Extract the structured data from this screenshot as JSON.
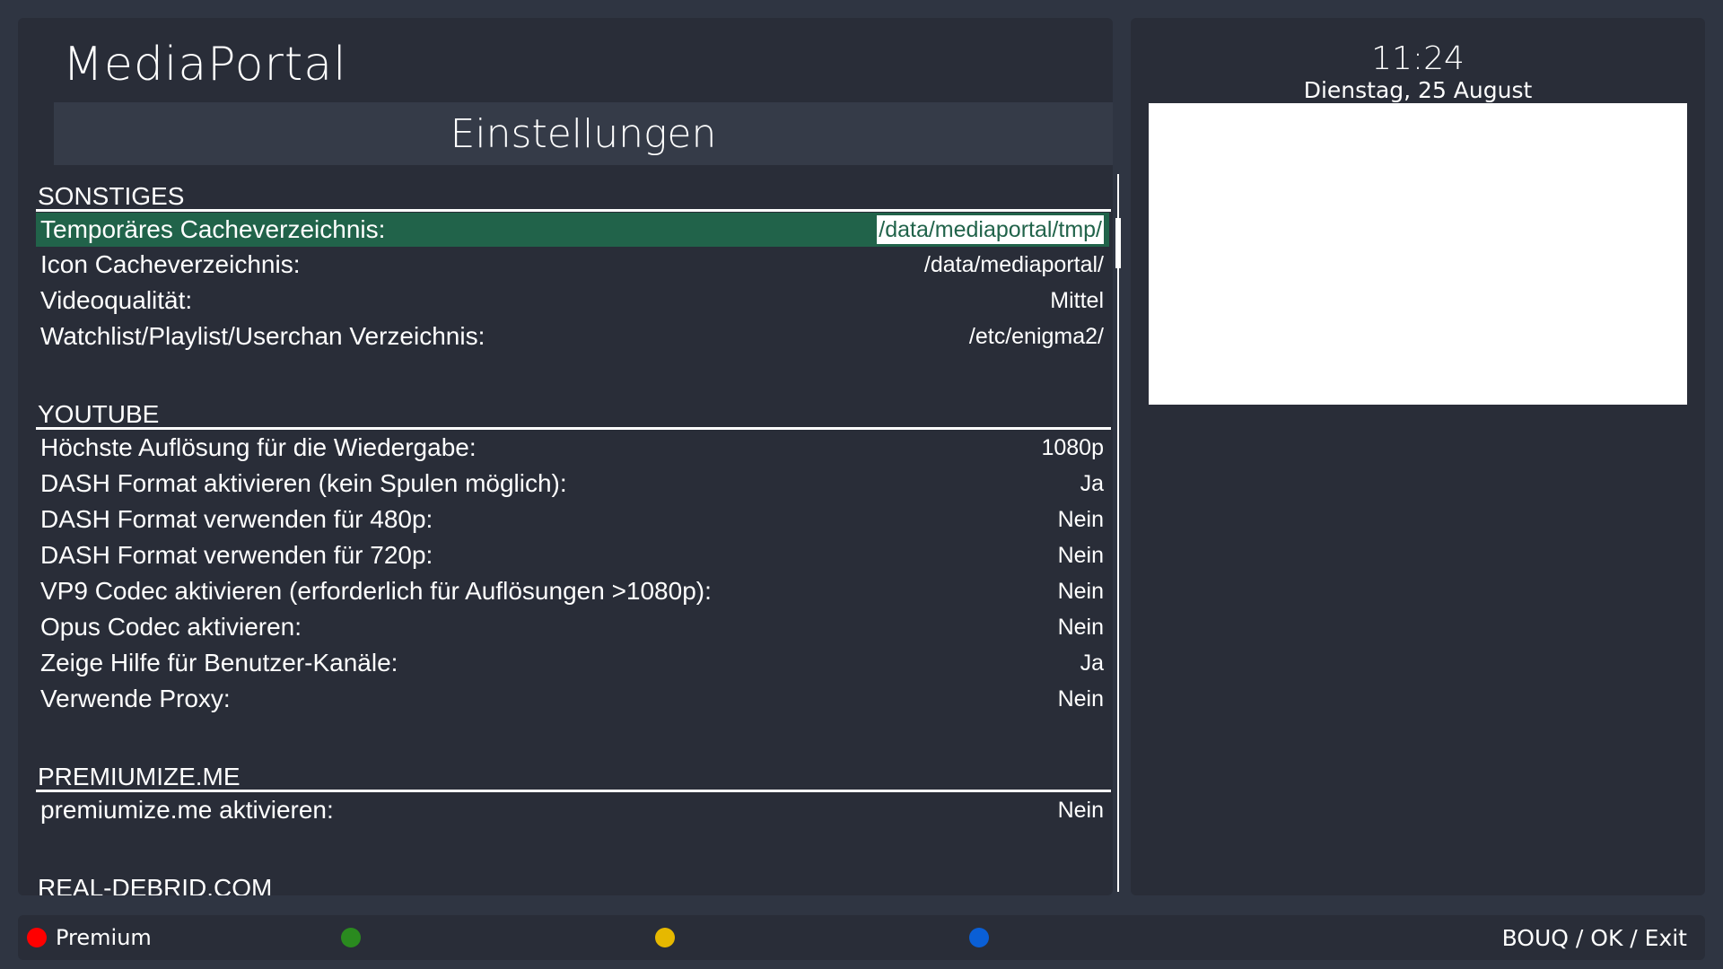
{
  "app": {
    "title": "MediaPortal",
    "screen_title": "Einstellungen"
  },
  "clock": {
    "time": "11:24",
    "date": "Dienstag, 25 August"
  },
  "sections": [
    {
      "header": "SONSTIGES",
      "items": [
        {
          "label": "Temporäres Cacheverzeichnis:",
          "value": "/data/mediaportal/tmp/",
          "selected": true
        },
        {
          "label": "Icon Cacheverzeichnis:",
          "value": "/data/mediaportal/"
        },
        {
          "label": "Videoqualität:",
          "value": "Mittel"
        },
        {
          "label": "Watchlist/Playlist/Userchan Verzeichnis:",
          "value": "/etc/enigma2/"
        }
      ]
    },
    {
      "header": "YOUTUBE",
      "items": [
        {
          "label": "Höchste Auflösung für die Wiedergabe:",
          "value": "1080p"
        },
        {
          "label": "DASH Format aktivieren (kein Spulen möglich):",
          "value": "Ja"
        },
        {
          "label": "DASH Format verwenden für 480p:",
          "value": "Nein"
        },
        {
          "label": "DASH Format verwenden für 720p:",
          "value": "Nein"
        },
        {
          "label": "VP9 Codec aktivieren (erforderlich für Auflösungen >1080p):",
          "value": "Nein"
        },
        {
          "label": "Opus Codec aktivieren:",
          "value": "Nein"
        },
        {
          "label": "Zeige Hilfe für Benutzer-Kanäle:",
          "value": "Ja"
        },
        {
          "label": "Verwende Proxy:",
          "value": "Nein"
        }
      ]
    },
    {
      "header": "PREMIUMIZE.ME",
      "items": [
        {
          "label": "premiumize.me aktivieren:",
          "value": "Nein"
        }
      ]
    },
    {
      "header": "REAL-DEBRID.COM",
      "items": []
    }
  ],
  "color_buttons": [
    {
      "name": "red",
      "color": "#ff0000",
      "label": "Premium"
    },
    {
      "name": "green",
      "color": "#2a8a1f",
      "label": ""
    },
    {
      "name": "yellow",
      "color": "#e6b800",
      "label": ""
    },
    {
      "name": "blue",
      "color": "#0a5fd6",
      "label": ""
    }
  ],
  "help_text": "BOUQ / OK / Exit",
  "colors": {
    "selection": "#21634a",
    "panel": "#292d38",
    "background": "#2f3542"
  }
}
